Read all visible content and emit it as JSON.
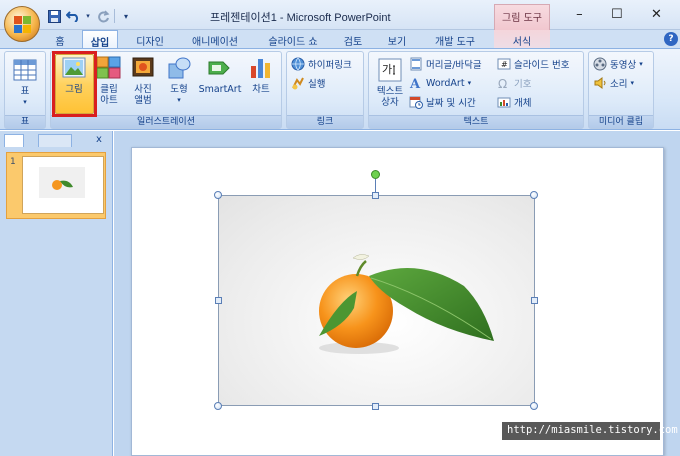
{
  "window": {
    "title": "프레젠테이션1 - Microsoft PowerPoint",
    "context_tab_header": "그림 도구",
    "controls": [
      "–",
      "☐",
      "✕"
    ]
  },
  "tabs": [
    {
      "label": "홈"
    },
    {
      "label": "삽입"
    },
    {
      "label": "디자인"
    },
    {
      "label": "애니메이션"
    },
    {
      "label": "슬라이드 쇼"
    },
    {
      "label": "검토"
    },
    {
      "label": "보기"
    },
    {
      "label": "개발 도구"
    },
    {
      "label": "서식"
    }
  ],
  "help_label": "?",
  "ribbon": {
    "groups": {
      "table": "표",
      "illustrations": "일러스트레이션",
      "link": "링크",
      "text": "텍스트",
      "media": "미디어 클립"
    },
    "buttons": {
      "table": "표",
      "picture": "그림",
      "clipart": "클립\n아트",
      "photo_album": "사진\n앨범",
      "shapes": "도형",
      "smartart": "SmartArt",
      "chart": "차트",
      "hyperlink": "하이퍼링크",
      "action": "실행",
      "textbox": "텍스트\n상자",
      "header_footer": "머리글/바닥글",
      "wordart": "WordArt",
      "datetime": "날짜 및 시간",
      "slide_number": "슬라이드 번호",
      "symbol": "기호",
      "object": "개체",
      "movie": "동영상",
      "sound": "소리"
    }
  },
  "slide_panel": {
    "thumbnail_number": "1",
    "close_label": "x"
  },
  "watermark": "http://miasmile.tistory.com",
  "colors": {
    "highlight_red": "#d91f1f",
    "ribbon_blue": "#15428b",
    "orange": "#f5961e",
    "leaf": "#3f8a2c"
  }
}
